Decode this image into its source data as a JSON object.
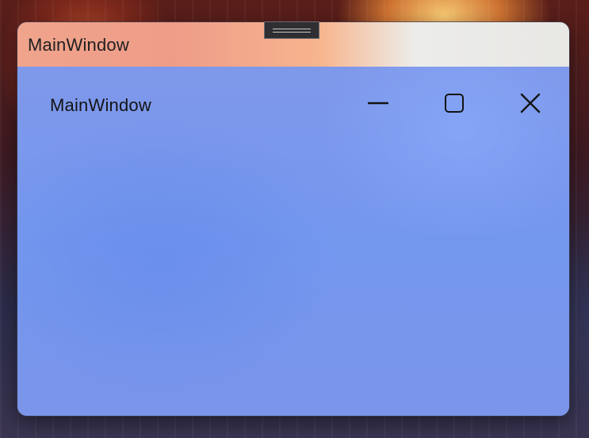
{
  "outer_window": {
    "title": "MainWindow"
  },
  "inner_window": {
    "title": "MainWindow",
    "controls": {
      "minimize_icon": "minimize-icon",
      "maximize_icon": "maximize-icon",
      "close_icon": "close-icon"
    }
  },
  "drag_handle": {
    "icon": "drag-handle-icon"
  },
  "colors": {
    "titlebar_start": "#f0a48c",
    "titlebar_end": "#e8e7e4",
    "client_background": "#7497ee",
    "icon_color": "#141414"
  }
}
